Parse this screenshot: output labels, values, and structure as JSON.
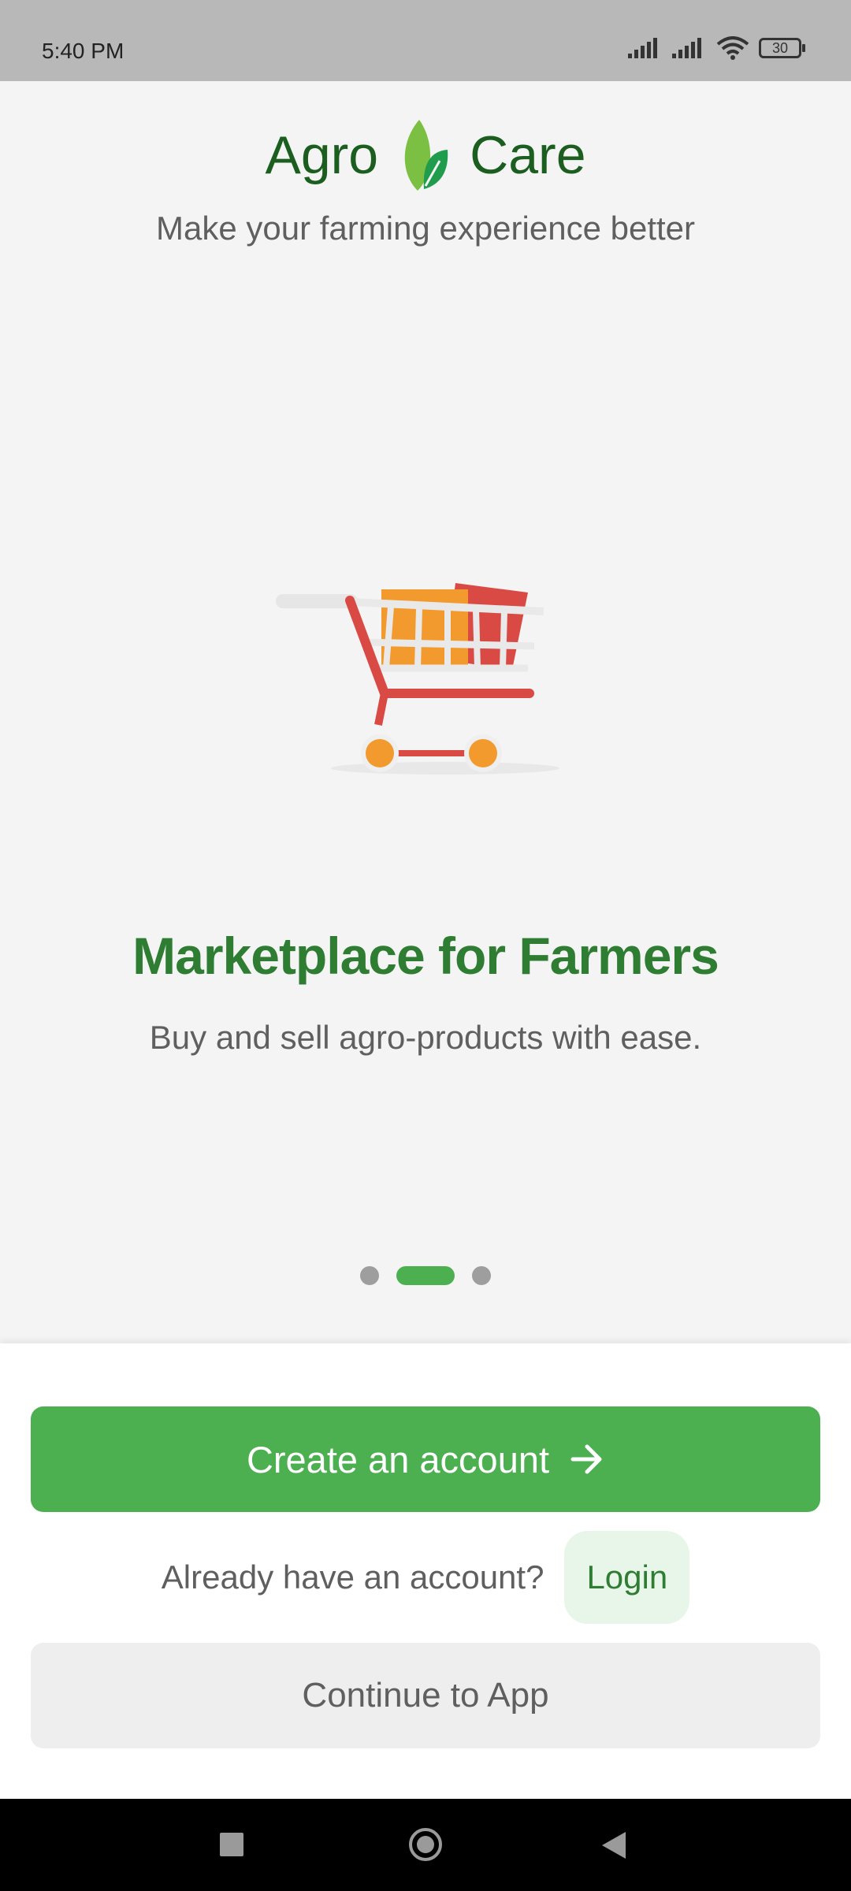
{
  "status_bar": {
    "time": "5:40 PM",
    "battery": "30",
    "icons": [
      "signal-icon",
      "signal-icon",
      "wifi-icon",
      "battery-icon"
    ]
  },
  "brand": {
    "name_left": "Agro",
    "name_right": "Care",
    "logo_icon": "leaf-icon",
    "tagline": "Make your farming experience better",
    "colors": {
      "brand_dark": "#1b5e20",
      "accent": "#4caf50"
    }
  },
  "slide": {
    "illustration": "shopping-cart-icon",
    "title": "Marketplace for Farmers",
    "description": "Buy and sell agro-products with ease.",
    "page_count": 3,
    "active_index": 1
  },
  "actions": {
    "create_account": "Create an account",
    "create_account_icon": "arrow-right-icon",
    "login_question": "Already have an account?",
    "login": "Login",
    "continue": "Continue to App"
  },
  "nav": {
    "icons": [
      "recents-icon",
      "home-icon",
      "back-icon"
    ]
  }
}
